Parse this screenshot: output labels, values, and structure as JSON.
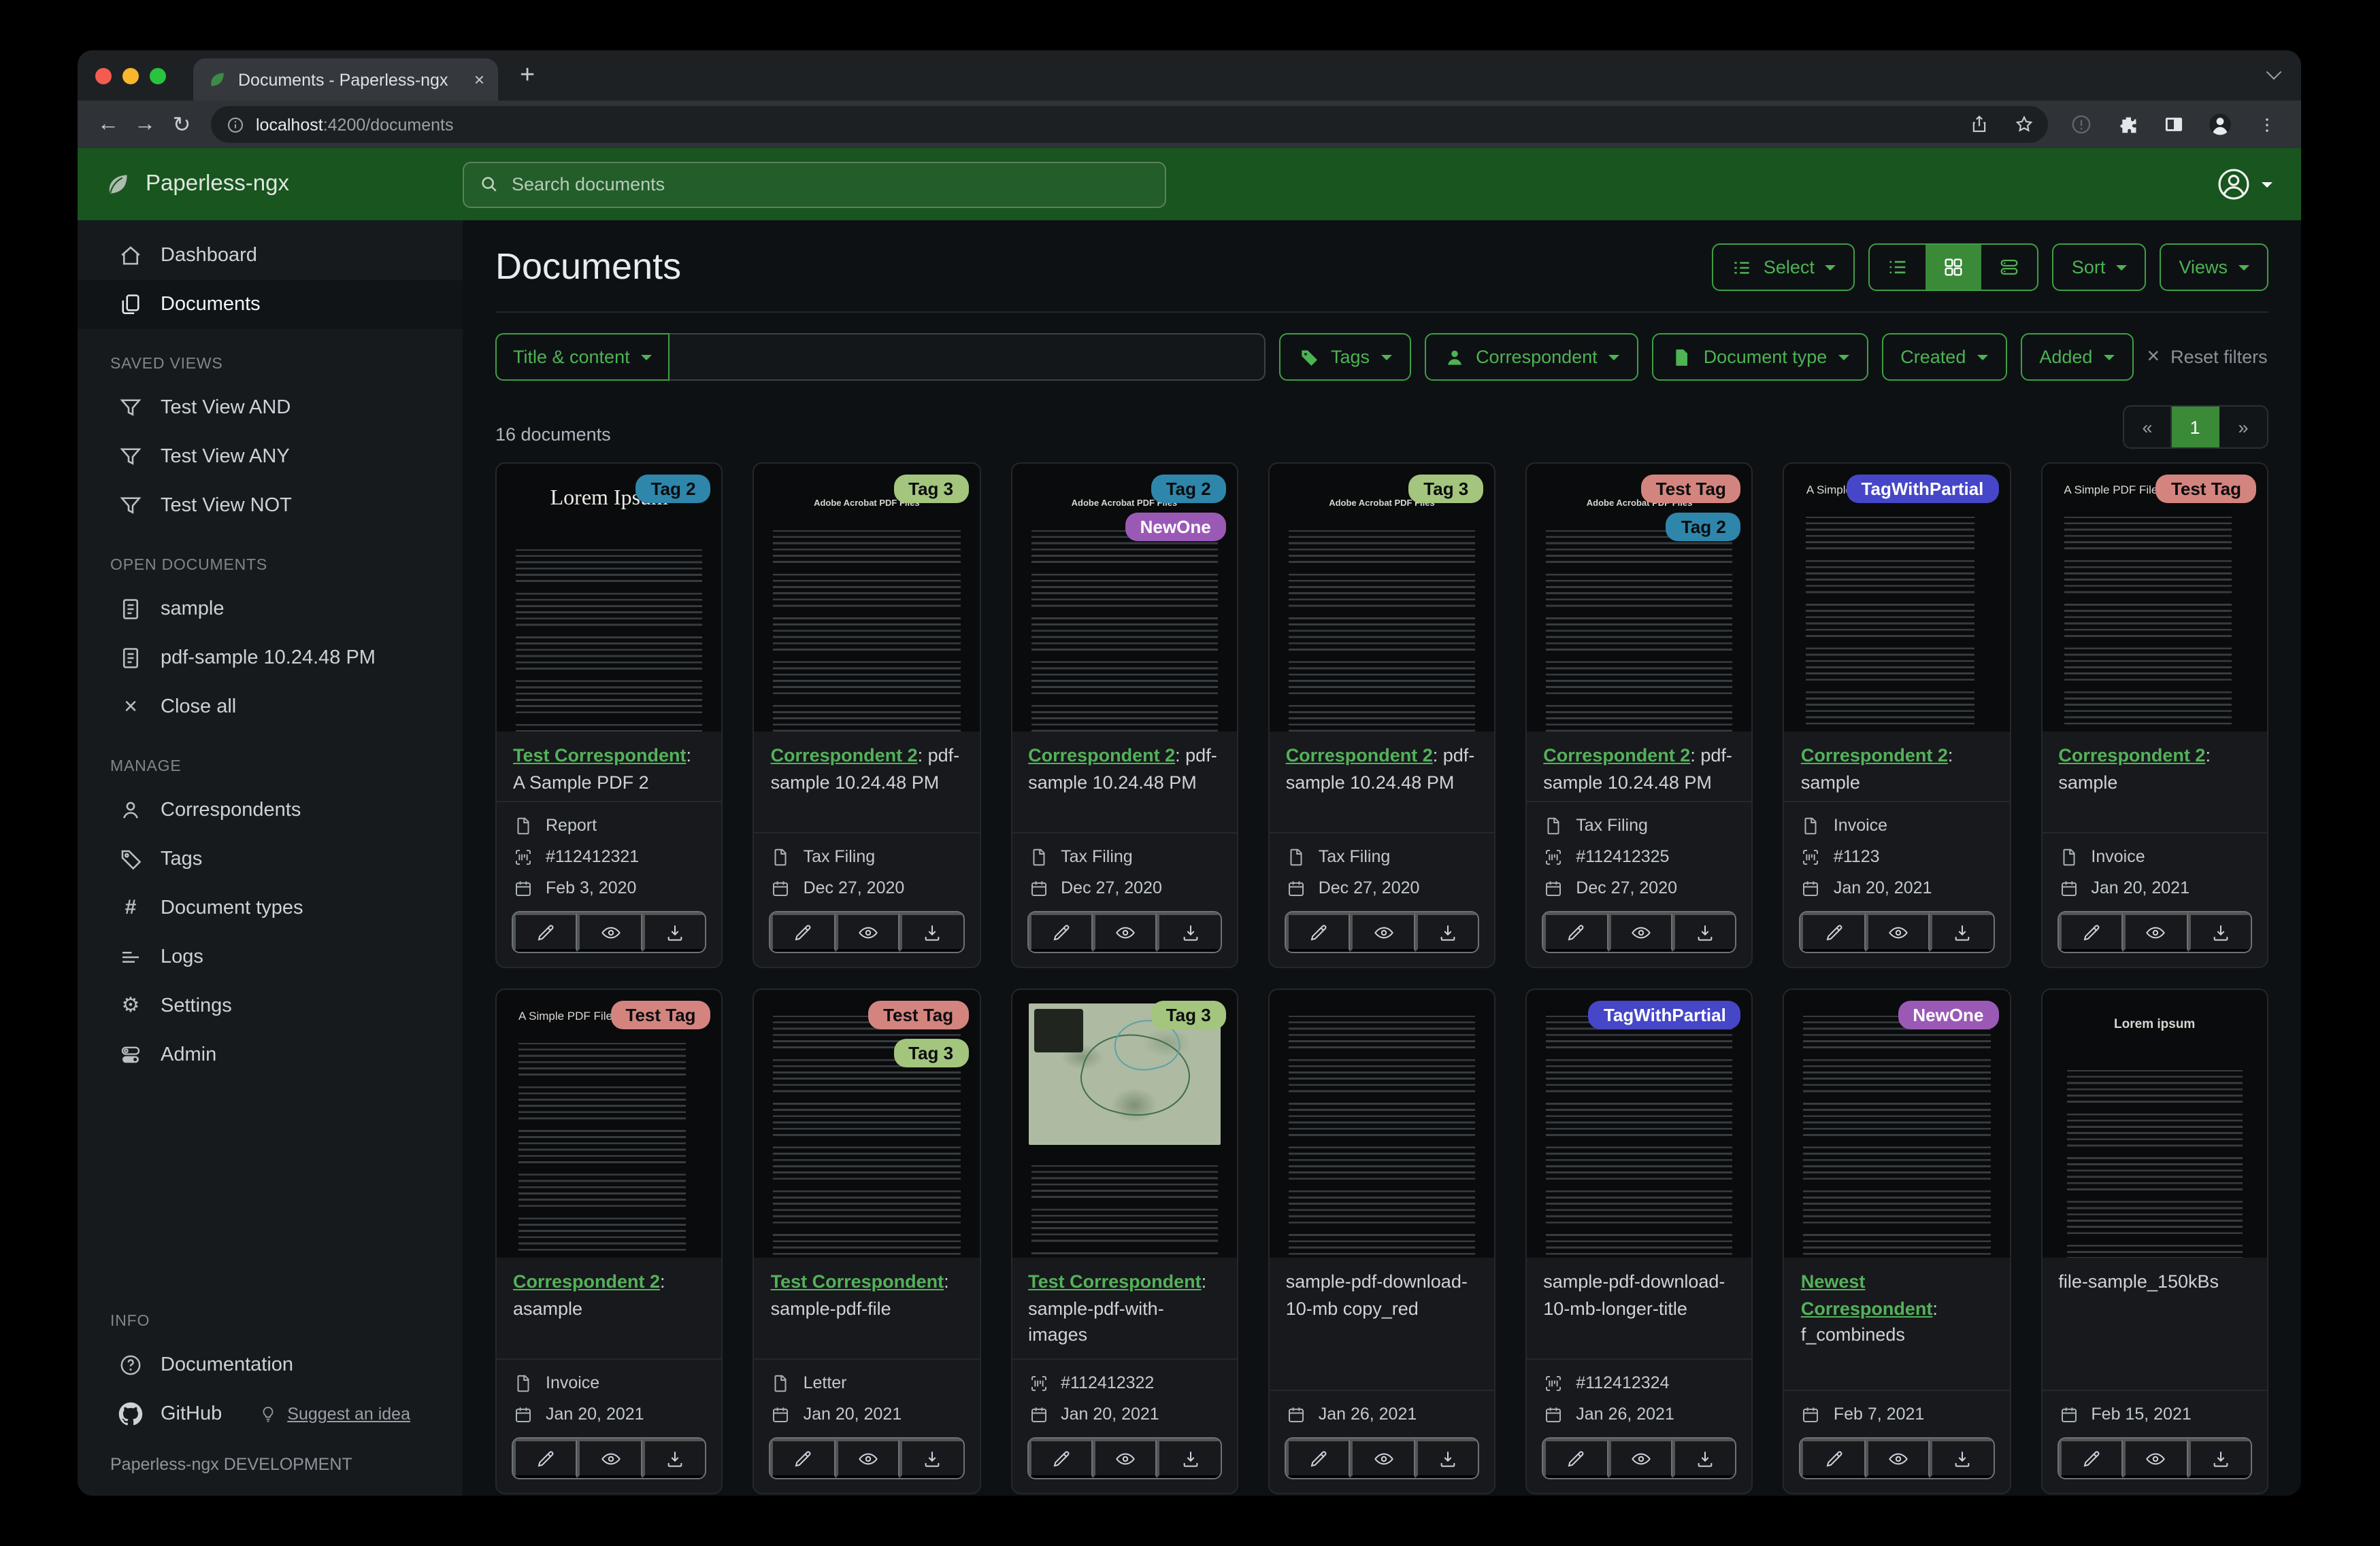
{
  "browser": {
    "tab_title": "Documents - Paperless-ngx",
    "tab_close": "×",
    "new_tab": "+",
    "url_host": "localhost",
    "url_rest": ":4200/documents"
  },
  "header": {
    "brand": "Paperless-ngx",
    "search_placeholder": "Search documents"
  },
  "sidebar": {
    "dashboard": "Dashboard",
    "documents": "Documents",
    "saved_views_head": "SAVED VIEWS",
    "saved_views": [
      "Test View AND",
      "Test View ANY",
      "Test View NOT"
    ],
    "open_docs_head": "OPEN DOCUMENTS",
    "open_docs": [
      "sample",
      "pdf-sample 10.24.48 PM"
    ],
    "close_all": "Close all",
    "manage_head": "MANAGE",
    "manage": [
      "Correspondents",
      "Tags",
      "Document types",
      "Logs",
      "Settings",
      "Admin"
    ],
    "info_head": "INFO",
    "documentation": "Documentation",
    "github": "GitHub",
    "suggest": "Suggest an idea",
    "footer": "Paperless-ngx DEVELOPMENT"
  },
  "page": {
    "title": "Documents",
    "select_label": "Select",
    "sort_label": "Sort",
    "views_label": "Views",
    "filter_field": "Title & content",
    "filter_tags": "Tags",
    "filter_correspondent": "Correspondent",
    "filter_doctype": "Document type",
    "filter_created": "Created",
    "filter_added": "Added",
    "reset": "Reset filters",
    "count": "16 documents",
    "pager_prev": "«",
    "pager_page": "1",
    "pager_next": "»"
  },
  "colors": {
    "header_green": "#18551f",
    "accent_green": "#4db353",
    "active_green": "#3a8a38",
    "link_green": "#54b15a"
  },
  "tag_styles": {
    "Tag 2": {
      "bg": "#2e86ab",
      "fg": "#0b0d0e"
    },
    "Tag 3": {
      "bg": "#a3c57d",
      "fg": "#0b0d0e"
    },
    "NewOne": {
      "bg": "#9b59b6",
      "fg": "#ffffff"
    },
    "Test Tag": {
      "bg": "#d4847f",
      "fg": "#0b0d0e"
    },
    "TagWithPartial": {
      "bg": "#4646c8",
      "fg": "#ffffff"
    }
  },
  "cards": [
    {
      "tags": [
        "Tag 2"
      ],
      "thumb": "lorem-serif",
      "thumb_heading": "Lorem Ipsum",
      "link": "Test Correspondent",
      "rest": ": A Sample PDF 2",
      "type": "Report",
      "asn": "#112412321",
      "date": "Feb 3, 2020"
    },
    {
      "tags": [
        "Tag 3"
      ],
      "thumb": "acrobat",
      "thumb_heading": "Adobe Acrobat PDF Files",
      "link": "Correspondent 2",
      "rest": ": pdf-sample 10.24.48 PM",
      "type": "Tax Filing",
      "date": "Dec 27, 2020"
    },
    {
      "tags": [
        "Tag 2",
        "NewOne"
      ],
      "thumb": "acrobat",
      "thumb_heading": "Adobe Acrobat PDF Files",
      "link": "Correspondent 2",
      "rest": ": pdf-sample 10.24.48 PM",
      "type": "Tax Filing",
      "date": "Dec 27, 2020"
    },
    {
      "tags": [
        "Tag 3"
      ],
      "thumb": "acrobat",
      "thumb_heading": "Adobe Acrobat PDF Files",
      "link": "Correspondent 2",
      "rest": ": pdf-sample 10.24.48 PM",
      "type": "Tax Filing",
      "date": "Dec 27, 2020"
    },
    {
      "tags": [
        "Test Tag",
        "Tag 2"
      ],
      "thumb": "acrobat",
      "thumb_heading": "Adobe Acrobat PDF Files",
      "link": "Correspondent 2",
      "rest": ": pdf-sample 10.24.48 PM",
      "type": "Tax Filing",
      "asn": "#112412325",
      "date": "Dec 27, 2020"
    },
    {
      "tags": [
        "TagWithPartial"
      ],
      "thumb": "simple",
      "thumb_heading": "A Simple PDF File",
      "link": "Correspondent 2",
      "rest": ": sample",
      "type": "Invoice",
      "asn": "#1123",
      "date": "Jan 20, 2021"
    },
    {
      "tags": [
        "Test Tag"
      ],
      "thumb": "simple",
      "thumb_heading": "A Simple PDF File",
      "link": "Correspondent 2",
      "rest": ": sample",
      "type": "Invoice",
      "date": "Jan 20, 2021"
    },
    {
      "tags": [
        "Test Tag"
      ],
      "thumb": "simple",
      "thumb_heading": "A Simple PDF File",
      "link": "Correspondent 2",
      "rest": ": asample",
      "type": "Invoice",
      "date": "Jan 20, 2021"
    },
    {
      "tags": [
        "Test Tag",
        "Tag 3"
      ],
      "thumb": "dense",
      "link": "Test Correspondent",
      "rest": ": sample-pdf-file",
      "type": "Letter",
      "date": "Jan 20, 2021"
    },
    {
      "tags": [
        "Tag 3"
      ],
      "thumb": "map",
      "link": "Test Correspondent",
      "rest": ": sample-pdf-with-images",
      "asn": "#112412322",
      "date": "Jan 20, 2021"
    },
    {
      "tags": [],
      "thumb": "dense",
      "title": "sample-pdf-download-10-mb copy_red",
      "date": "Jan 26, 2021"
    },
    {
      "tags": [
        "TagWithPartial"
      ],
      "thumb": "dense",
      "title": "sample-pdf-download-10-mb-longer-title",
      "asn": "#112412324",
      "date": "Jan 26, 2021"
    },
    {
      "tags": [
        "NewOne"
      ],
      "thumb": "dense",
      "link": "Newest Correspondent",
      "rest": ": f_combineds",
      "date": "Feb 7, 2021"
    },
    {
      "tags": [],
      "thumb": "lorem-article",
      "thumb_heading": "Lorem ipsum",
      "title": "file-sample_150kBs",
      "date": "Feb 15, 2021"
    }
  ]
}
